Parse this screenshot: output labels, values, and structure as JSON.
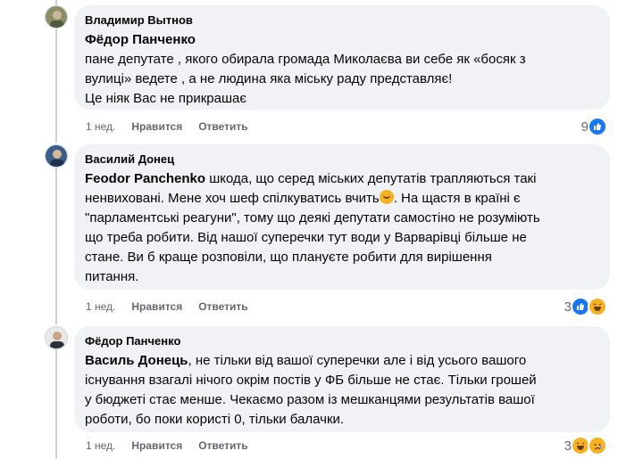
{
  "comments": [
    {
      "author": "Владимир Вытнов",
      "mention": "Фёдор Панченко",
      "lines": [
        "пане депутате , якого обирала громада Миколаєва ви себе як «босяк з",
        "вулиці» ведете , а не людина яка міську раду представляє!",
        "Це ніяк Вас не прикрашає"
      ],
      "time": "1 нед.",
      "like": "Нравится",
      "reply": "Ответить",
      "reaction_count": "9",
      "reaction_icons": [
        "like-icon"
      ]
    },
    {
      "author": "Василий Донец",
      "mention": "Feodor Panchenko",
      "first_line_rest": " шкода, що серед міських депутатів трапляються такі",
      "lines": [
        "ненвиховані. Мене хоч шеф спілкуватись вчить",
        ". На щастя в країні є",
        "\"парламентські реагуни\", тому що деякі депутати самостіно не розуміють",
        "що треба робити. Від нашої суперечки тут води у Варварівці більше не",
        "стане. Ви б краще розповіли, що плануєте робити для вирішення",
        "питання."
      ],
      "time": "1 нед.",
      "like": "Нравится",
      "reply": "Ответить",
      "reaction_count": "3",
      "reaction_icons": [
        "like-icon",
        "haha-icon"
      ]
    },
    {
      "author": "Фёдор Панченко",
      "mention": "Василь Донець",
      "first_line_rest": ", не тільки від вашої суперечки але і від усього вашого",
      "lines": [
        "існування взагалі нічого окрім постів у ФБ більше не стає. Тільки грошей",
        "у бюджеті стає менше. Чекаємо разом із мешканцями результатів вашої",
        "роботи, бо поки користі 0, тільки балачки."
      ],
      "time": "1 нед.",
      "like": "Нравится",
      "reply": "Ответить",
      "reaction_count": "3",
      "reaction_icons": [
        "haha-icon",
        "sad-icon"
      ]
    }
  ]
}
